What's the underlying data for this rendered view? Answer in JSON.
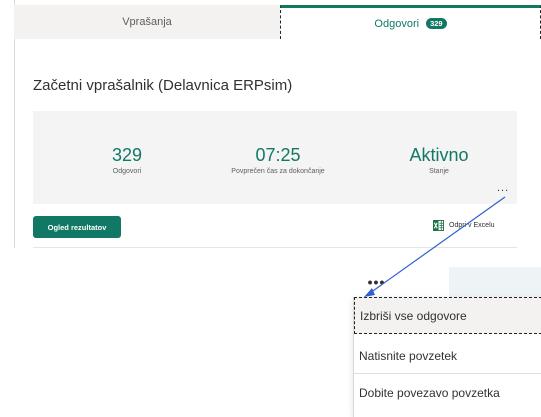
{
  "tabs": {
    "questions_label": "Vprašanja",
    "responses_label": "Odgovori",
    "responses_count": "329"
  },
  "form_title": "Začetni vprašalnik (Delavnica ERPsim)",
  "stats": [
    {
      "value": "329",
      "label": "Odgovori"
    },
    {
      "value": "07:25",
      "label": "Povprečen čas za dokončanje"
    },
    {
      "value": "Aktivno",
      "label": "Stanje"
    }
  ],
  "more_glyph": "...",
  "view_results_label": "Ogled rezultatov",
  "open_excel_label": "Odpri v Excelu",
  "menu": {
    "trigger_glyph": "•••",
    "items": [
      "Izbriši vse odgovore",
      "Natisnite povzetek",
      "Dobite povezavo povzetka"
    ]
  },
  "colors": {
    "accent": "#117865",
    "annotation_arrow": "#2f5fcf"
  },
  "icons": {
    "excel": "excel-icon",
    "more": "more-horizontal-icon",
    "arrow": "annotation-arrow"
  }
}
